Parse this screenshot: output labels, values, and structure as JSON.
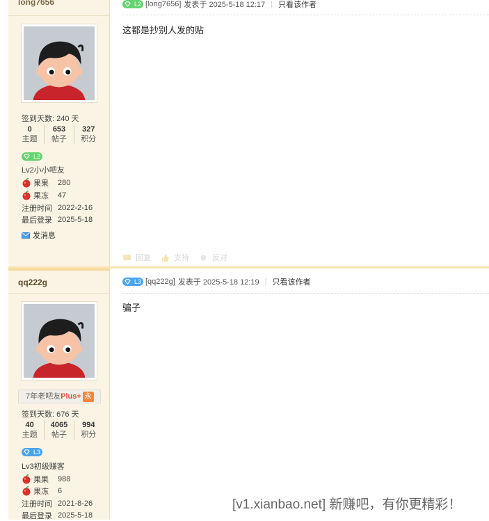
{
  "colors": {
    "sidebar_bg": "#fbf4e4",
    "level_green": "#63d36f",
    "level_blue": "#4ba4ef",
    "plus_red": "#e14b3b",
    "separator": "#f8e3b3"
  },
  "posts": [
    {
      "username": "long7656",
      "sign_days": "签到天数: 240 天",
      "stats": [
        {
          "num": "0",
          "label": "主题"
        },
        {
          "num": "653",
          "label": "帖子"
        },
        {
          "num": "327",
          "label": "积分"
        }
      ],
      "level_badge": "L2",
      "level_title": "Lv2小小吧友",
      "fruit1_label": "果果",
      "fruit1_value": "280",
      "fruit2_label": "果冻",
      "fruit2_value": "47",
      "reg_label": "注册时间",
      "reg_value": "2022-2-16",
      "last_label": "最后登录",
      "last_value": "2025-5-18",
      "send_msg": "发消息",
      "meta_user": "[long7656]",
      "meta_posted": "发表于 2025-5-18 12:17",
      "only_author": "只看该作者",
      "content": "这都是抄别人发的贴",
      "actions": [
        "回复",
        "支持",
        "反对"
      ]
    },
    {
      "username": "qq222g",
      "plus_prefix": "7年老吧友",
      "plus_label": "Plus+",
      "plus_badge": "永",
      "sign_days": "签到天数: 676 天",
      "stats": [
        {
          "num": "40",
          "label": "主题"
        },
        {
          "num": "4065",
          "label": "帖子"
        },
        {
          "num": "994",
          "label": "积分"
        }
      ],
      "level_badge": "L3",
      "level_title": "Lv3初级赚客",
      "fruit1_label": "果果",
      "fruit1_value": "988",
      "fruit2_label": "果冻",
      "fruit2_value": "6",
      "reg_label": "注册时间",
      "reg_value": "2021-8-26",
      "last_label": "最后登录",
      "last_value": "2025-5-18",
      "meta_user": "[qq222g]",
      "meta_posted": "发表于 2025-5-18 12:19",
      "only_author": "只看该作者",
      "content": "骗子"
    }
  ],
  "watermark": "[v1.xianbao.net] 新赚吧，有你更精彩！",
  "icons": [
    "avatar-cartoon",
    "gem-icon",
    "apple-icon",
    "mail-icon",
    "reply-icon",
    "thumb-up-icon",
    "thumb-down-icon"
  ]
}
